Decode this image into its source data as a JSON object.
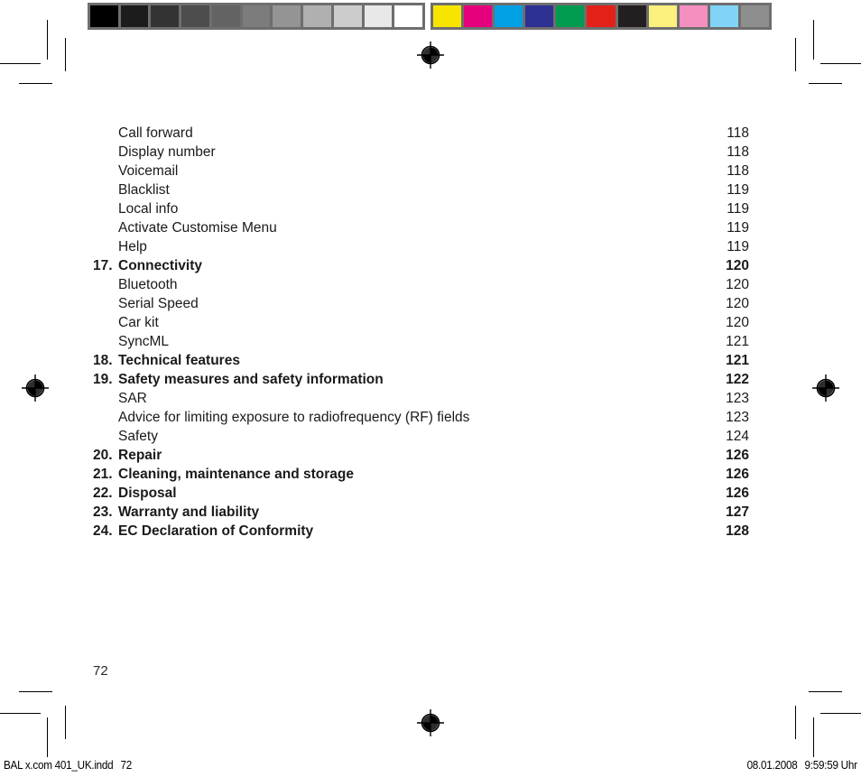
{
  "document": {
    "page_number_folio": "72",
    "type": "table-of-contents"
  },
  "calibration": {
    "grayscale_label": "grayscale-calibration-bar",
    "grayscale_swatches": [
      "#000000",
      "#1c1c1c",
      "#333333",
      "#4d4d4d",
      "#636363",
      "#7c7c7c",
      "#949494",
      "#b0b0b0",
      "#cccccc",
      "#e8e8e8",
      "#ffffff"
    ],
    "color_label": "color-calibration-bar",
    "color_swatches": [
      "#f7e500",
      "#e5007d",
      "#00a0e4",
      "#2e3192",
      "#009b4e",
      "#e32119",
      "#231f20",
      "#fbef7e",
      "#f48fc0",
      "#81d4f7",
      "#8e8e8e"
    ],
    "frame_color": "#6e6e6e"
  },
  "toc": {
    "rows": [
      {
        "style": "sub",
        "num": "",
        "label": "Call forward",
        "page": "118"
      },
      {
        "style": "sub",
        "num": "",
        "label": "Display number",
        "page": "118"
      },
      {
        "style": "sub",
        "num": "",
        "label": "Voicemail",
        "page": "118"
      },
      {
        "style": "sub",
        "num": "",
        "label": "Blacklist",
        "page": "119"
      },
      {
        "style": "sub",
        "num": "",
        "label": "Local info",
        "page": "119"
      },
      {
        "style": "sub",
        "num": "",
        "label": "Activate Customise Menu",
        "page": "119"
      },
      {
        "style": "sub",
        "num": "",
        "label": "Help",
        "page": "119"
      },
      {
        "style": "main",
        "num": "17.",
        "label": "Connectivity",
        "page": "120"
      },
      {
        "style": "sub",
        "num": "",
        "label": "Bluetooth",
        "page": "120"
      },
      {
        "style": "sub",
        "num": "",
        "label": "Serial Speed",
        "page": "120"
      },
      {
        "style": "sub",
        "num": "",
        "label": "Car kit",
        "page": "120"
      },
      {
        "style": "sub",
        "num": "",
        "label": "SyncML",
        "page": "121"
      },
      {
        "style": "main",
        "num": "18.",
        "label": "Technical features",
        "page": "121"
      },
      {
        "style": "main",
        "num": "19.",
        "label": "Safety measures and safety information",
        "page": "122"
      },
      {
        "style": "sub",
        "num": "",
        "label": "SAR",
        "page": "123"
      },
      {
        "style": "sub",
        "num": "",
        "label": "Advice for limiting exposure to radiofrequency (RF) fields",
        "page": "123"
      },
      {
        "style": "sub",
        "num": "",
        "label": "Safety",
        "page": "124"
      },
      {
        "style": "main",
        "num": "20.",
        "label": "Repair",
        "page": "126"
      },
      {
        "style": "main",
        "num": "21.",
        "label": "Cleaning, maintenance and storage",
        "page": "126"
      },
      {
        "style": "main",
        "num": "22.",
        "label": "Disposal",
        "page": "126"
      },
      {
        "style": "main",
        "num": "23.",
        "label": "Warranty and liability",
        "page": "127"
      },
      {
        "style": "main",
        "num": "24.",
        "label": "EC Declaration of Conformity",
        "page": "128"
      }
    ]
  },
  "print_footer": {
    "file_name": "BAL x.com 401_UK.indd",
    "sheet_number": "72",
    "date": "08.01.2008",
    "time": "9:59:59 Uhr"
  }
}
